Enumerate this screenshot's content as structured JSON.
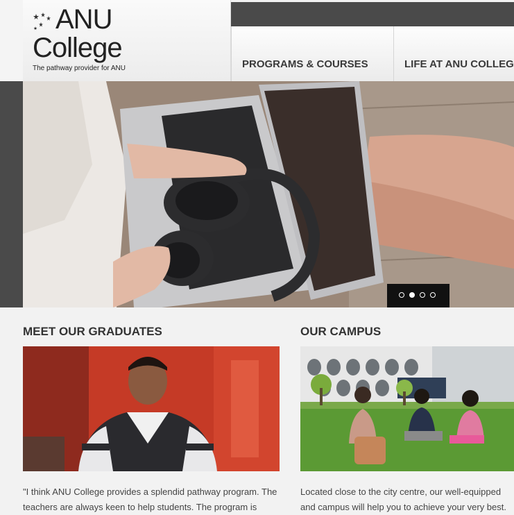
{
  "logo": {
    "title": "ANU",
    "subtitle": "College",
    "tagline": "The pathway provider for ANU"
  },
  "nav": {
    "items": [
      {
        "label": "PROGRAMS & COURSES"
      },
      {
        "label": "LIFE AT ANU COLLEGE"
      }
    ]
  },
  "hero": {
    "slide_count": 4,
    "active_slide": 2
  },
  "graduates": {
    "title": "MEET OUR GRADUATES",
    "text": "\"I think ANU College provides a splendid pathway program. The teachers are always keen to help students. The program is"
  },
  "campus": {
    "title": "OUR CAMPUS",
    "text": "Located close to the city centre, our well-equipped and campus will help you to achieve your very best."
  },
  "colors": {
    "dark_bar": "#4a4a4a",
    "background": "#f2f2f2",
    "slider_bg": "#111111"
  }
}
